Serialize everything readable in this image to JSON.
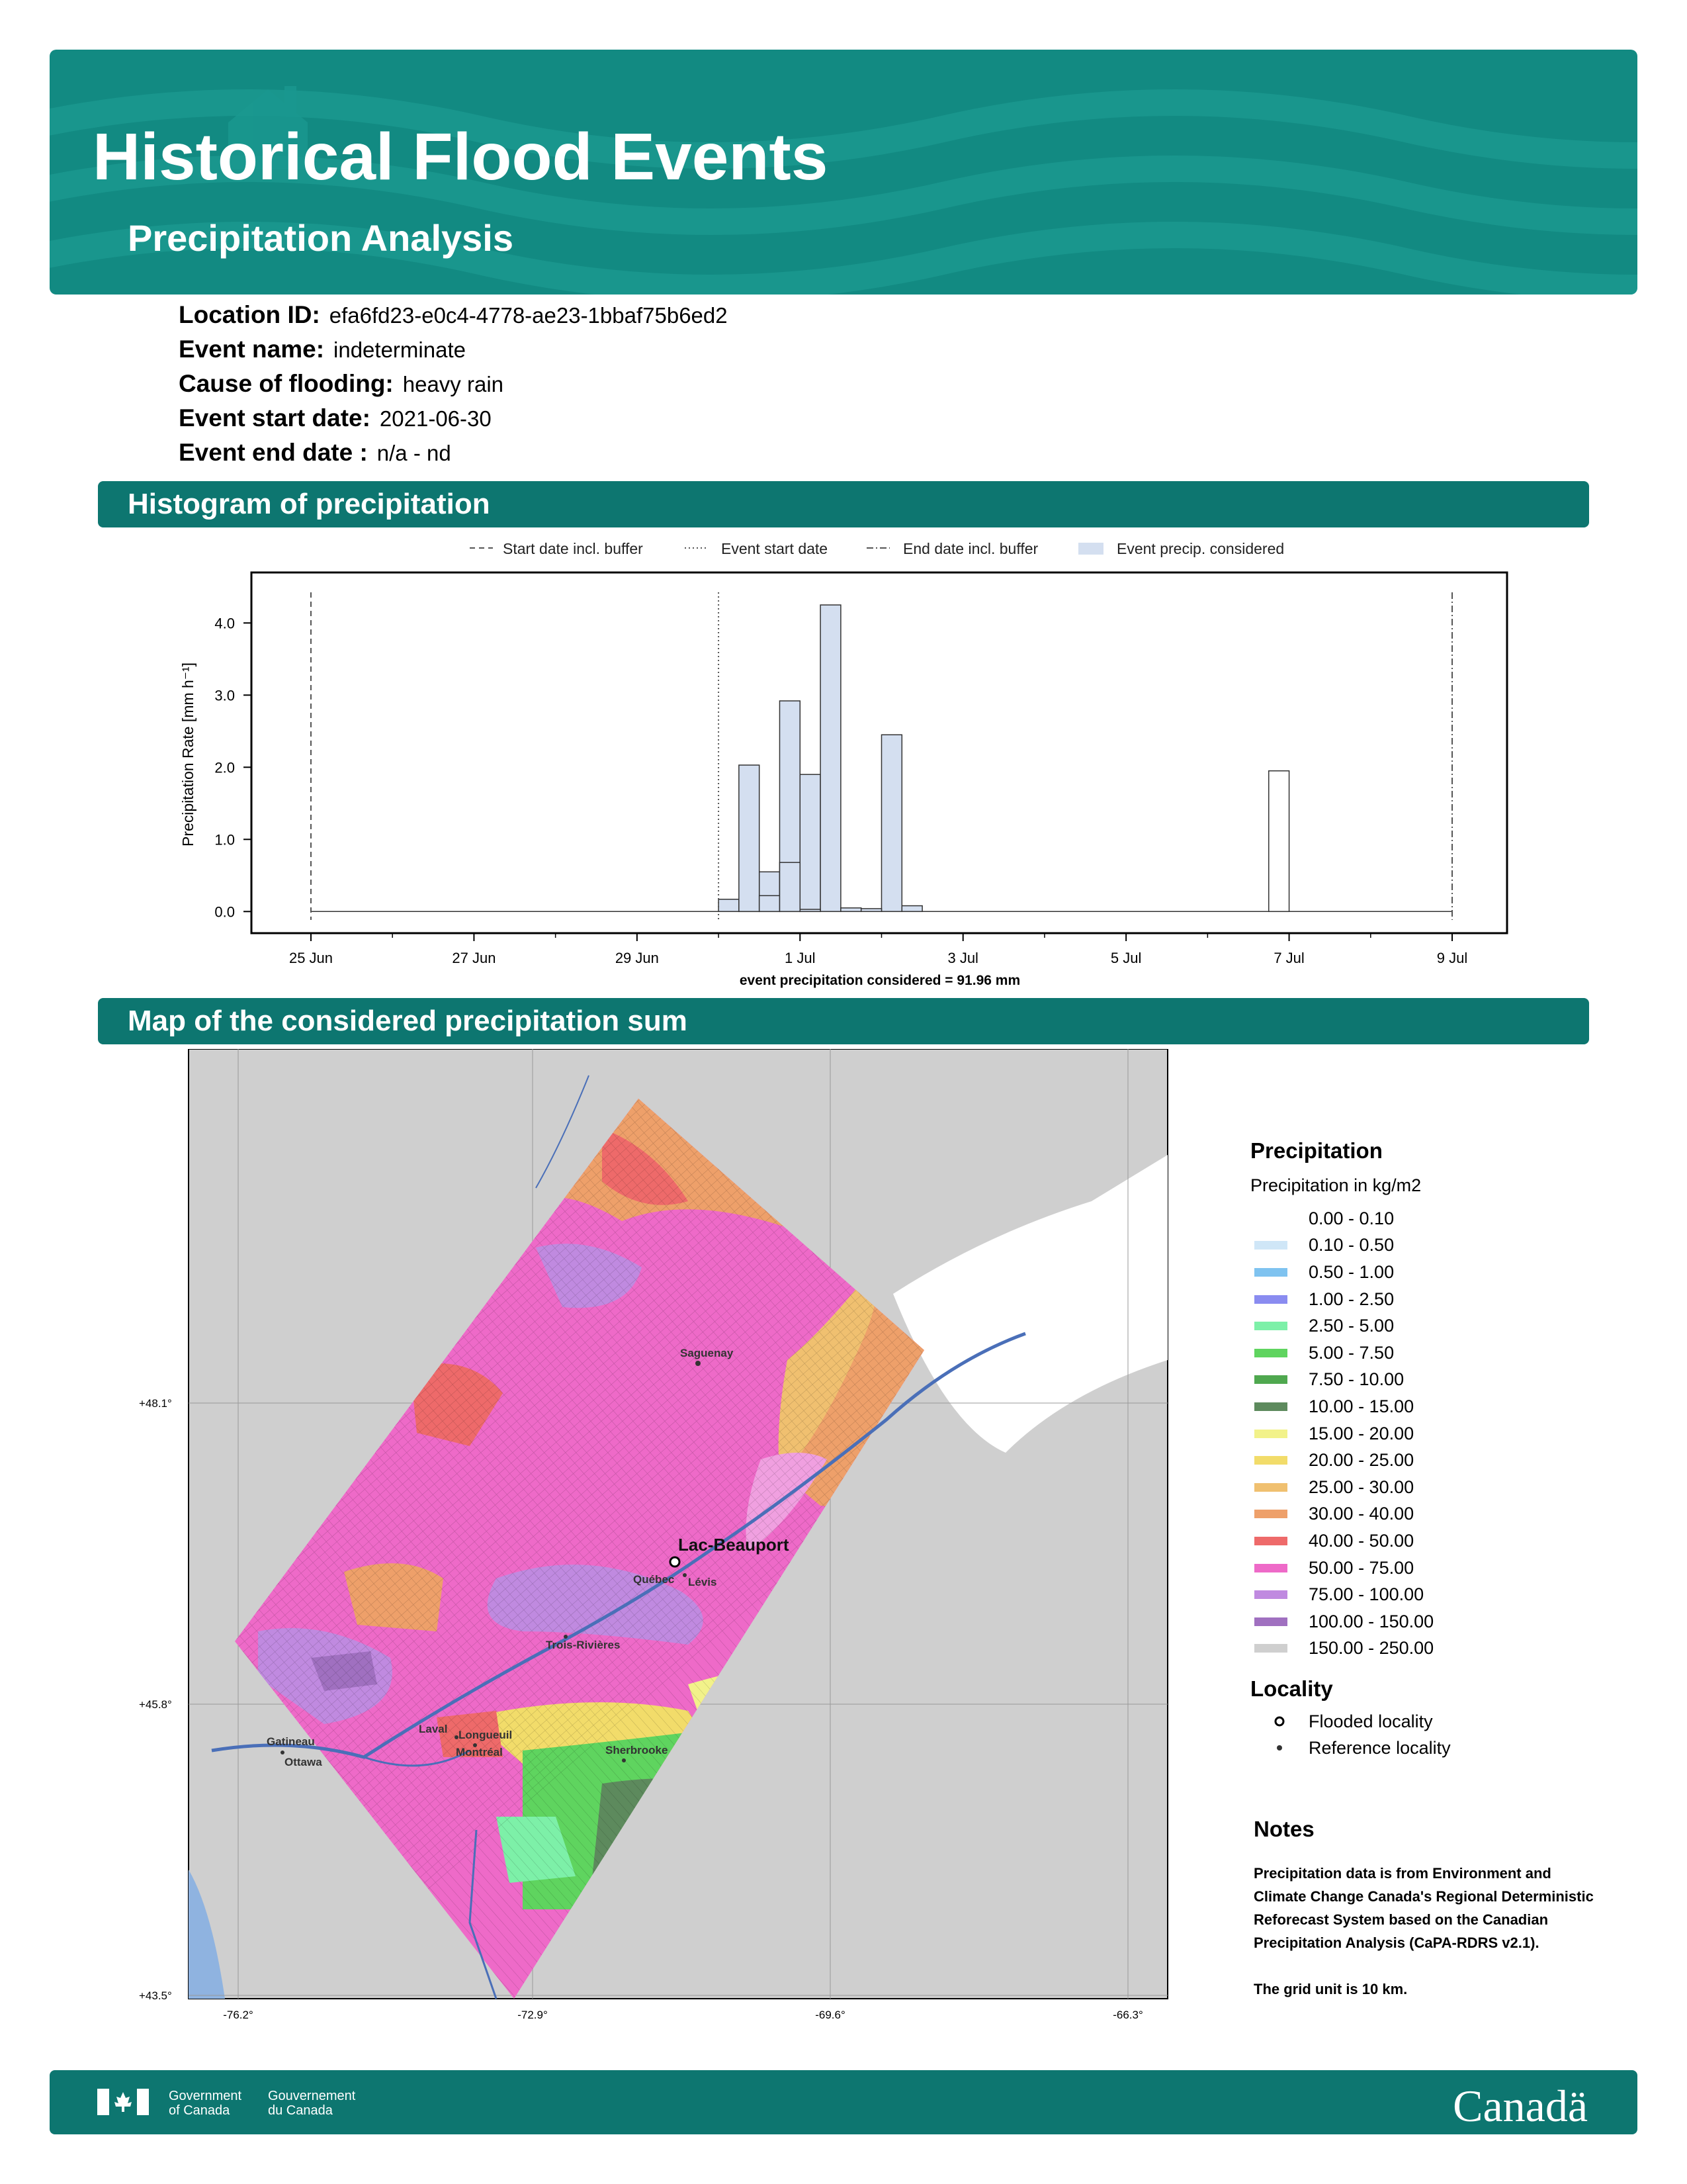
{
  "header": {
    "title": "Historical Flood Events",
    "subtitle": "Precipitation Analysis"
  },
  "meta": [
    {
      "label": "Location ID:",
      "value": "efa6fd23-e0c4-4778-ae23-1bbaf75b6ed2"
    },
    {
      "label": "Event name:",
      "value": "indeterminate"
    },
    {
      "label": "Cause of flooding:",
      "value": "heavy rain"
    },
    {
      "label": "Event start date:",
      "value": "2021-06-30"
    },
    {
      "label": "Event end date :",
      "value": "n/a - nd"
    }
  ],
  "sections": {
    "histogram": "Histogram of precipitation",
    "map": "Map of the considered precipitation sum"
  },
  "chart_data": {
    "type": "bar",
    "ylabel": "Precipitation Rate [mm h⁻¹]",
    "xlabel": "event precipitation considered = 91.96 mm",
    "ylim": [
      -0.3,
      4.7
    ],
    "yticks": [
      "0.0",
      "1.0",
      "2.0",
      "3.0",
      "4.0"
    ],
    "xticks": [
      "25 Jun",
      "27 Jun",
      "29 Jun",
      "1 Jul",
      "3 Jul",
      "5 Jul",
      "7 Jul",
      "9 Jul"
    ],
    "legend": [
      "Start date incl. buffer",
      "Event start date",
      "End date incl. buffer",
      "Event precip. considered"
    ],
    "bin_hours": 6,
    "start": "2021-06-25 00:00",
    "values": [
      0,
      0,
      0,
      0,
      0,
      0,
      0,
      0,
      0,
      0,
      0,
      0.03,
      0.55,
      2.92,
      1.9,
      4.25,
      0.05,
      0,
      2.45,
      0.08,
      0,
      0,
      0,
      0,
      0,
      0,
      0,
      0,
      0,
      0,
      0,
      0,
      0,
      0,
      0,
      0,
      0,
      0,
      0,
      0,
      0,
      0,
      0,
      0,
      0,
      0,
      0,
      0,
      0,
      0,
      0,
      0,
      0,
      0,
      0,
      0,
      0,
      0,
      0,
      0,
      0,
      0,
      0,
      0,
      0,
      0,
      0,
      0,
      0,
      0,
      0,
      0,
      0,
      0,
      0,
      0,
      0,
      0,
      0,
      0,
      0,
      0,
      0,
      0,
      0,
      0,
      0,
      0,
      0,
      0,
      0,
      0,
      0,
      0,
      0,
      0,
      0,
      0,
      0,
      0,
      0,
      0,
      0,
      0,
      0,
      0,
      0,
      0,
      0,
      0,
      0,
      0,
      0,
      0,
      0,
      0,
      0,
      0,
      0,
      0,
      0,
      0,
      0,
      0,
      0,
      0,
      0,
      0,
      0,
      0,
      0,
      0,
      0,
      0,
      0,
      0,
      0,
      0,
      0,
      0,
      0,
      0,
      0,
      0,
      0,
      0,
      0,
      0,
      0,
      0,
      0,
      0,
      0,
      0
    ],
    "event_values": [
      0.17,
      2.03,
      0.22,
      0.68,
      0.03,
      0,
      0,
      0.04
    ],
    "late_spike": {
      "date": "2021-07-06 18:00",
      "value": 1.95
    },
    "markers": {
      "start_buffer": "2021-06-25",
      "event_start": "2021-06-30",
      "end_buffer": "2021-07-09"
    }
  },
  "map": {
    "y_labels": [
      "+48.1°",
      "+45.8°",
      "+43.5°"
    ],
    "x_labels": [
      "-76.2°",
      "-72.9°",
      "-69.6°",
      "-66.3°"
    ],
    "places": [
      {
        "name": "Saguenay"
      },
      {
        "name": "Lac-Beauport"
      },
      {
        "name": "Québec"
      },
      {
        "name": "Lévis"
      },
      {
        "name": "Trois-Rivières"
      },
      {
        "name": "Laval"
      },
      {
        "name": "Longueuil"
      },
      {
        "name": "Montréal"
      },
      {
        "name": "Gatineau"
      },
      {
        "name": "Ottawa"
      },
      {
        "name": "Sherbrooke"
      }
    ]
  },
  "legend": {
    "title": "Precipitation",
    "subtitle": "Precipitation in kg/m2",
    "ranges": [
      {
        "label": "0.00 - 0.10",
        "color": "#ffffff"
      },
      {
        "label": "0.10 - 0.50",
        "color": "#cfe6f7"
      },
      {
        "label": "0.50 - 1.00",
        "color": "#7fc3f0"
      },
      {
        "label": "1.00 - 2.50",
        "color": "#8a8cf0"
      },
      {
        "label": "2.50 - 5.00",
        "color": "#7df0a8"
      },
      {
        "label": "5.00 - 7.50",
        "color": "#5fd45f"
      },
      {
        "label": "7.50 - 10.00",
        "color": "#4fa84f"
      },
      {
        "label": "10.00 - 15.00",
        "color": "#5d8a5d"
      },
      {
        "label": "15.00 - 20.00",
        "color": "#f2f28a"
      },
      {
        "label": "20.00 - 25.00",
        "color": "#f2dc6a"
      },
      {
        "label": "25.00 - 30.00",
        "color": "#f0c070"
      },
      {
        "label": "30.00 - 40.00",
        "color": "#eea06a"
      },
      {
        "label": "40.00 - 50.00",
        "color": "#ee6a6a"
      },
      {
        "label": "50.00 - 75.00",
        "color": "#ee6ac8"
      },
      {
        "label": "75.00 - 100.00",
        "color": "#c08ae0"
      },
      {
        "label": "100.00 - 150.00",
        "color": "#a070c0"
      },
      {
        "label": "150.00 - 250.00",
        "color": "#cfcfcf"
      }
    ],
    "locality_title": "Locality",
    "flooded": "Flooded locality",
    "reference": "Reference locality"
  },
  "notes": {
    "title": "Notes",
    "text1": "Precipitation data is from Environment and Climate Change Canada's Regional Deterministic Reforecast System based on the Canadian Precipitation Analysis (CaPA-RDRS v2.1).",
    "text2": "The grid unit is 10 km."
  },
  "footer": {
    "gov_en_1": "Government",
    "gov_en_2": "of Canada",
    "gov_fr_1": "Gouvernement",
    "gov_fr_2": "du Canada",
    "wordmark": "Canadä"
  }
}
